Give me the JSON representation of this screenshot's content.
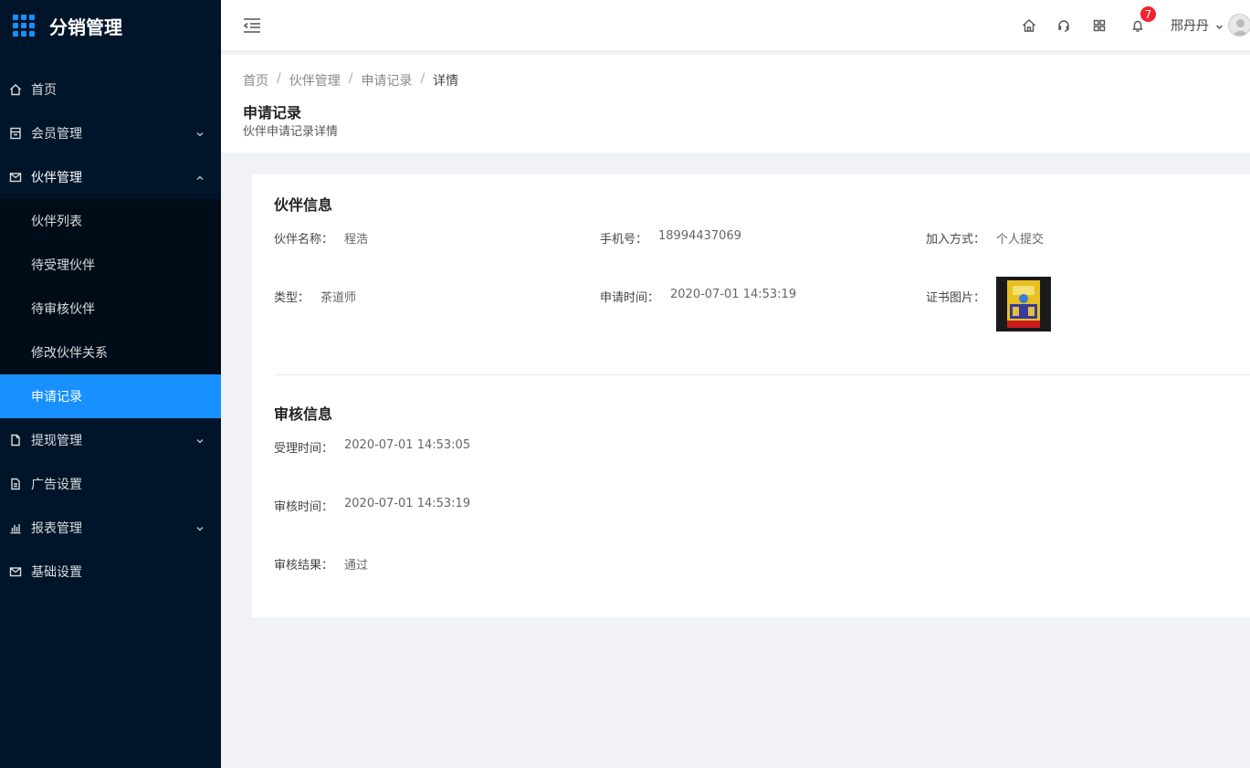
{
  "app": {
    "title": "分销管理"
  },
  "sidebar": {
    "items": [
      {
        "label": "首页"
      },
      {
        "label": "会员管理"
      },
      {
        "label": "伙伴管理",
        "children": [
          "伙伴列表",
          "待受理伙伴",
          "待审核伙伴",
          "修改伙伴关系",
          "申请记录"
        ]
      },
      {
        "label": "提现管理"
      },
      {
        "label": "广告设置"
      },
      {
        "label": "报表管理"
      },
      {
        "label": "基础设置"
      }
    ]
  },
  "header": {
    "notification_count": "7",
    "user_name": "邢丹丹"
  },
  "breadcrumb": [
    "首页",
    "伙伴管理",
    "申请记录",
    "详情"
  ],
  "page": {
    "title": "申请记录",
    "subtitle": "伙伴申请记录详情"
  },
  "partner_info": {
    "title": "伙伴信息",
    "name_label": "伙伴名称：",
    "name_value": "程浩",
    "phone_label": "手机号：",
    "phone_value": "18994437069",
    "join_label": "加入方式：",
    "join_value": "个人提交",
    "type_label": "类型：",
    "type_value": "茶道师",
    "apply_time_label": "申请时间：",
    "apply_time_value": "2020-07-01 14:53:19",
    "cert_label": "证书图片："
  },
  "review_info": {
    "title": "审核信息",
    "accept_time_label": "受理时间：",
    "accept_time_value": "2020-07-01 14:53:05",
    "review_time_label": "审核时间：",
    "review_time_value": "2020-07-01 14:53:19",
    "result_label": "审核结果：",
    "result_value": "通过"
  },
  "colors": {
    "sidebar_bg": "#001529",
    "submenu_bg": "#000c17",
    "accent": "#1890ff",
    "badge": "#f5222d"
  }
}
